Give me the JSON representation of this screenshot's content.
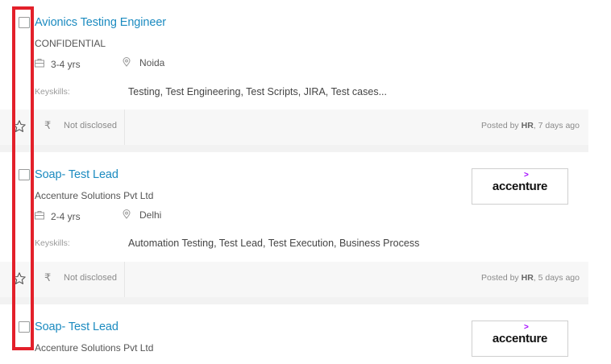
{
  "jobs": [
    {
      "title": "Avionics Testing Engineer",
      "company": "CONFIDENTIAL",
      "experience": "3-4 yrs",
      "location": "Noida",
      "keyskills_label": "Keyskills:",
      "keyskills": "Testing, Test Engineering, Test Scripts, JIRA, Test cases...",
      "salary": "Not disclosed",
      "currency_symbol": "₹",
      "posted_prefix": "Posted by",
      "posted_by": "HR",
      "posted_age": ", 7 days ago"
    },
    {
      "title": "Soap- Test Lead",
      "company": "Accenture Solutions Pvt Ltd",
      "experience": "2-4 yrs",
      "location": "Delhi",
      "keyskills_label": "Keyskills:",
      "keyskills": "Automation Testing, Test Lead, Test Execution, Business Process",
      "salary": "Not disclosed",
      "currency_symbol": "₹",
      "posted_prefix": "Posted by",
      "posted_by": "HR",
      "posted_age": ", 5 days ago",
      "logo_text": "accenture",
      "logo_mark": ">"
    },
    {
      "title": "Soap- Test Lead",
      "company": "Accenture Solutions Pvt Ltd",
      "logo_text": "accenture",
      "logo_mark": ">"
    }
  ],
  "icons": {
    "experience": "briefcase-icon",
    "location": "location-pin-icon",
    "save": "star-icon",
    "salary": "rupee-icon"
  },
  "colors": {
    "title": "#1c8bc0",
    "highlight": "#e3202a",
    "brand_accent": "#a100ff"
  }
}
